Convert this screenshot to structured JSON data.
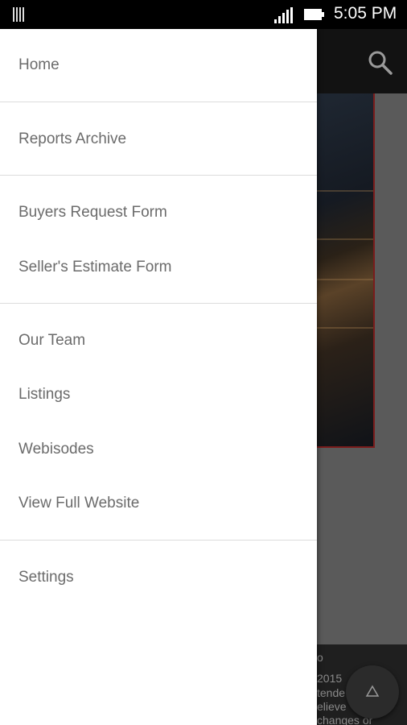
{
  "status_bar": {
    "time": "5:05 PM",
    "icons": [
      "notification-icon",
      "signal-icon",
      "battery-icon"
    ]
  },
  "app": {
    "toolbar_icon": "search-icon",
    "fab_icon": "chevron-up-icon",
    "footer_lines": [
      "o",
      "2015",
      "tende",
      "elieve",
      "changes or"
    ]
  },
  "drawer": {
    "sections": [
      {
        "items": [
          {
            "label": "Home"
          }
        ]
      },
      {
        "items": [
          {
            "label": "Reports Archive"
          }
        ]
      },
      {
        "items": [
          {
            "label": "Buyers Request Form"
          },
          {
            "label": "Seller's Estimate Form"
          }
        ]
      },
      {
        "items": [
          {
            "label": "Our Team"
          },
          {
            "label": "Listings"
          },
          {
            "label": "Webisodes"
          },
          {
            "label": "View Full Website"
          }
        ]
      },
      {
        "items": [
          {
            "label": "Settings"
          }
        ]
      }
    ]
  },
  "colors": {
    "drawer_bg": "#ffffff",
    "item_text": "#6b6b6b",
    "divider": "#dcdcdc",
    "scrim": "#5a5a5a"
  }
}
